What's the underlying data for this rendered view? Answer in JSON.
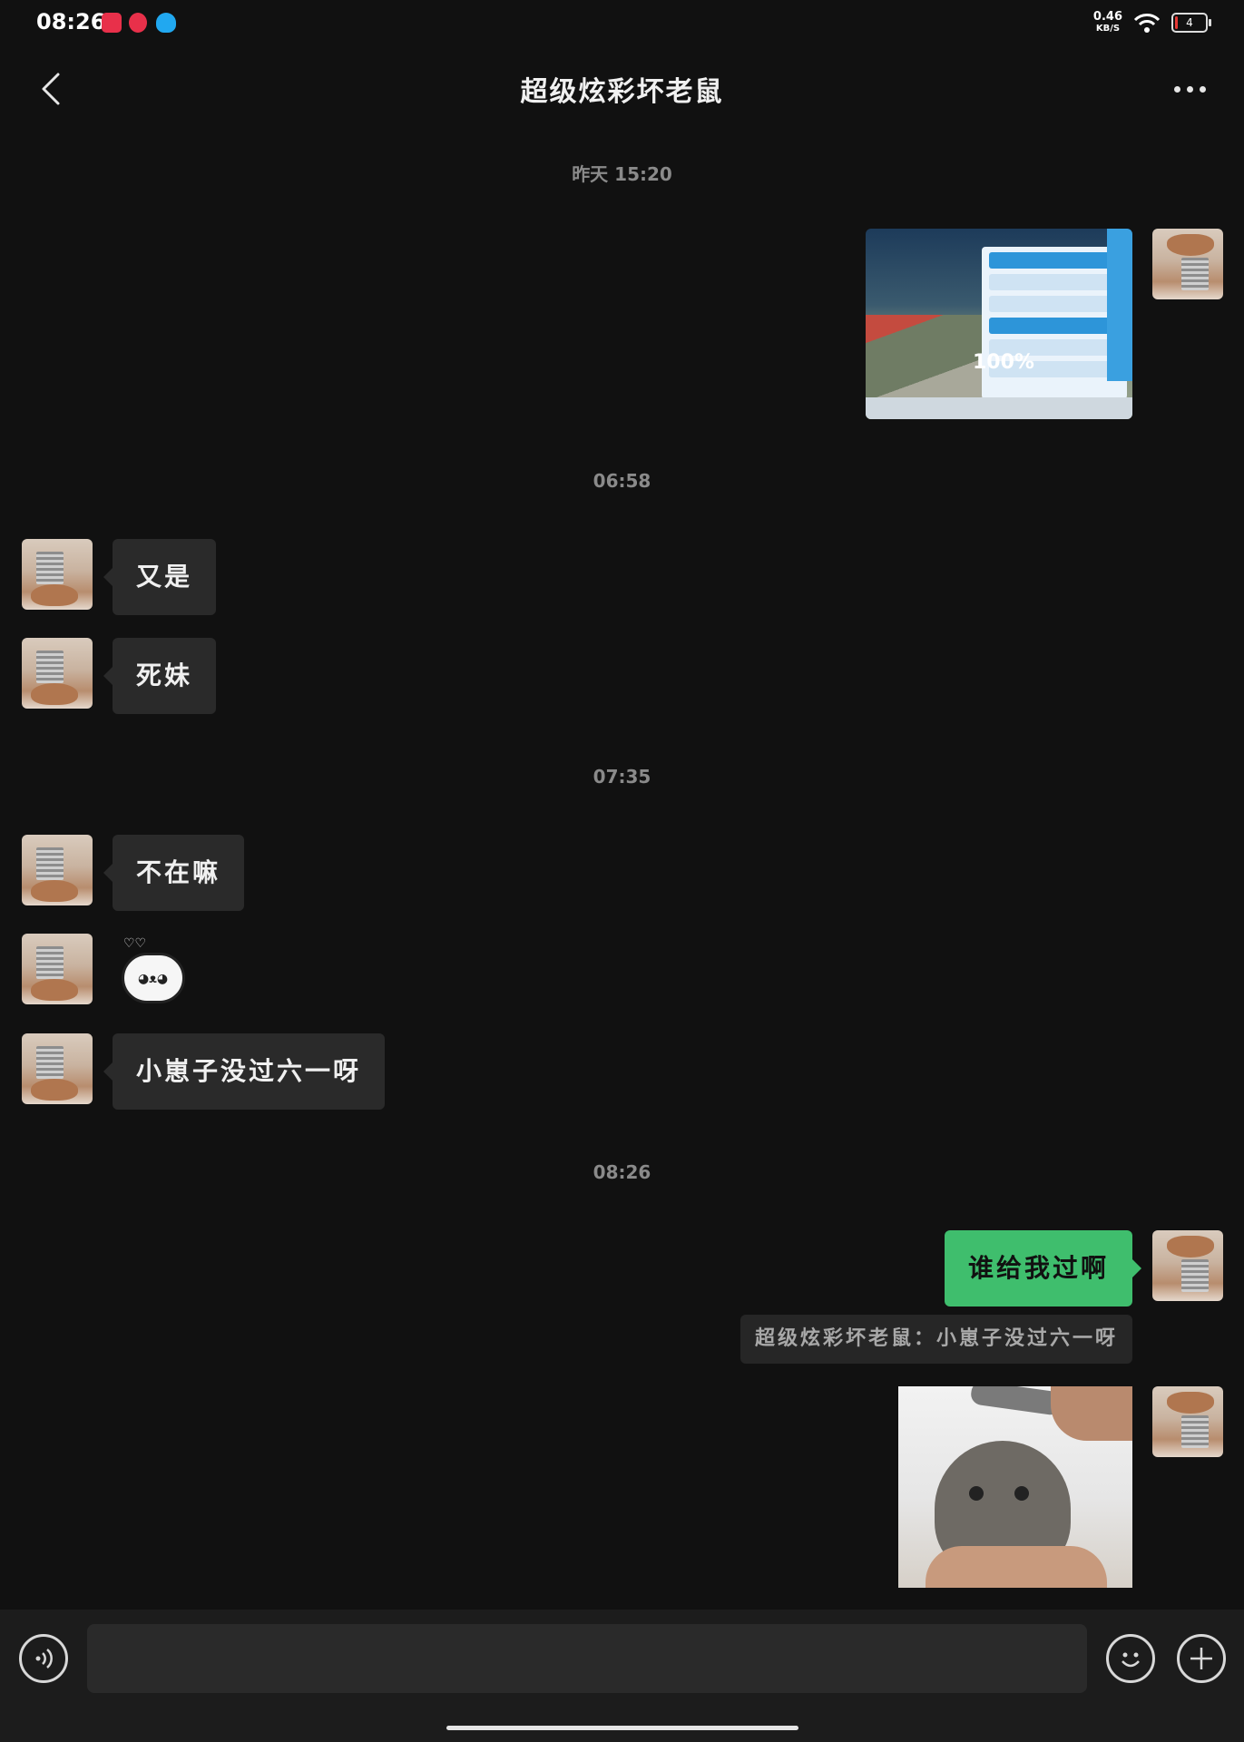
{
  "status_bar": {
    "time": "08:26",
    "net_speed_value": "0.46",
    "net_speed_unit": "KB/S",
    "battery": "4",
    "app_icons": [
      "red-app-icon",
      "douyin-icon",
      "qq-icon"
    ],
    "colors": {
      "red_app": "#e8304a",
      "douyin": "#e8304a",
      "qq": "#21a8f0"
    }
  },
  "header": {
    "title": "超级炫彩坏老鼠"
  },
  "timestamps": [
    "昨天 15:20",
    "06:58",
    "07:35",
    "08:26"
  ],
  "messages": {
    "m1": {
      "text": "又是"
    },
    "m2": {
      "text": "死妹"
    },
    "m3": {
      "text": "不在嘛"
    },
    "m5": {
      "text": "小崽子没过六一呀"
    },
    "m6": {
      "text": "谁给我过啊"
    },
    "quote": {
      "text": "超级炫彩坏老鼠：小崽子没过六一呀"
    }
  },
  "screenshot_image": {
    "badge": "100%"
  },
  "input": {
    "value": ""
  },
  "colors": {
    "bubble_sent": "#3fbe6d",
    "bubble_received": "#2a2a2a",
    "background": "#111111"
  }
}
